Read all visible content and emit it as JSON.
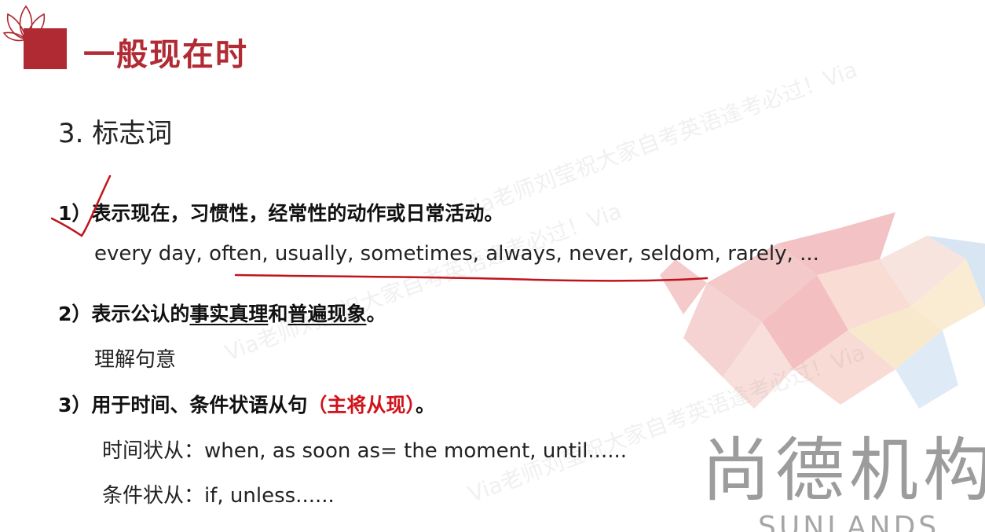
{
  "header": {
    "title": "一般现在时"
  },
  "section": {
    "title": "3. 标志词"
  },
  "items": [
    {
      "num": "1）",
      "text": "表示现在，习惯性，经常性的动作或日常活动。",
      "examples": "every day, often, usually, sometimes, always, never, seldom, rarely, ..."
    },
    {
      "num": "2）",
      "text_a": "表示公认的",
      "text_b": "事实真理",
      "text_c": "和",
      "text_d": "普遍现象",
      "text_e": "。",
      "note": "理解句意"
    },
    {
      "num": "3）",
      "text_a": "用于时间、条件状语从句",
      "text_red": "（主将从现）",
      "text_e": "。",
      "line1": "时间状从：when, as soon as= the moment, until......",
      "line2": "条件状从：if, unless......"
    }
  ],
  "watermark": {
    "text": "Via老师刘莹祝大家自考英语逢考必过！Via"
  },
  "brand": {
    "name": "尚德机构",
    "sub": "SUNLANDS"
  },
  "colors": {
    "accent": "#b22a33",
    "highlight": "#d0121b",
    "annotation": "#c0141c"
  }
}
